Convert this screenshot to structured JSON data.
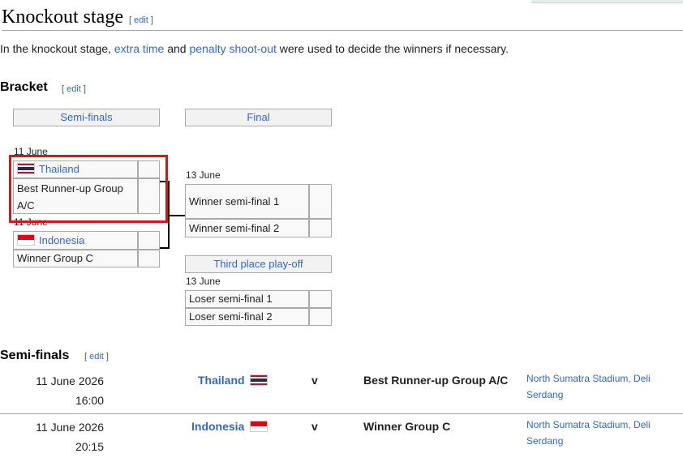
{
  "section": {
    "title": "Knockout stage",
    "edit_label": "edit",
    "intro_before": "In the knockout stage, ",
    "intro_link1": "extra time",
    "intro_mid": " and ",
    "intro_link2": "penalty shoot-out",
    "intro_after": " were used to decide the winners if necessary."
  },
  "bracket": {
    "heading": "Bracket",
    "edit_label": "edit",
    "round_headers": [
      "Semi-finals",
      "Final"
    ],
    "third_place_header": "Third place play-off",
    "semi1": {
      "date": "11 June",
      "team1": "Thailand",
      "team2": "Best Runner-up Group A/C"
    },
    "semi2": {
      "date": "11 June",
      "team1": "Indonesia",
      "team2": "Winner Group C"
    },
    "final": {
      "date": "13 June",
      "team1": "Winner semi-final 1",
      "team2": "Winner semi-final 2"
    },
    "third_place": {
      "date": "13 June",
      "team1": "Loser semi-final 1",
      "team2": "Loser semi-final 2"
    }
  },
  "semifinals": {
    "heading": "Semi-finals",
    "edit_label": "edit",
    "matches": [
      {
        "date": "11 June 2026",
        "time": "16:00",
        "home": "Thailand",
        "home_flag": "thailand-flag-icon",
        "v": "v",
        "away": "Best Runner-up Group A/C",
        "venue_line1": "North Sumatra Stadium, Deli",
        "venue_line2": "Serdang"
      },
      {
        "date": "11 June 2026",
        "time": "20:15",
        "home": "Indonesia",
        "home_flag": "indonesia-flag-icon",
        "v": "v",
        "away": "Winner Group C",
        "venue_line1": "North Sumatra Stadium, Deli",
        "venue_line2": "Serdang"
      }
    ]
  },
  "colors": {
    "link": "#3366cc",
    "highlight": "#d01a1a",
    "header_bg": "#f2f2f2",
    "cell_bg": "#f9f9f9"
  }
}
